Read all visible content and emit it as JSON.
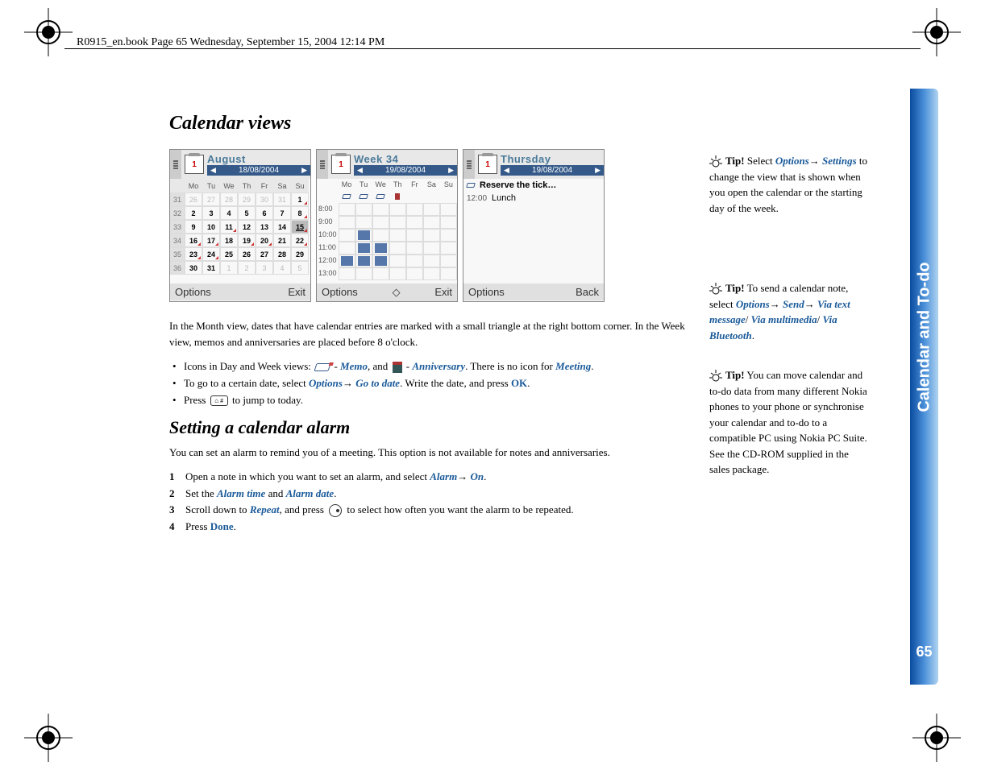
{
  "header": "R0915_en.book  Page 65  Wednesday, September 15, 2004  12:14 PM",
  "side_tab": {
    "label": "Calendar and To-do",
    "page": "65"
  },
  "section_title": "Calendar views",
  "screenshots": {
    "month": {
      "title": "August",
      "date": "18/08/2004",
      "days": [
        "Mo",
        "Tu",
        "We",
        "Th",
        "Fr",
        "Sa",
        "Su"
      ],
      "weeks": [
        "31",
        "32",
        "33",
        "34",
        "35",
        "36"
      ],
      "grid": [
        [
          "26",
          "27",
          "28",
          "29",
          "30",
          "31",
          "1"
        ],
        [
          "2",
          "3",
          "4",
          "5",
          "6",
          "7",
          "8"
        ],
        [
          "9",
          "10",
          "11",
          "12",
          "13",
          "14",
          "15"
        ],
        [
          "16",
          "17",
          "18",
          "19",
          "20",
          "21",
          "22"
        ],
        [
          "23",
          "24",
          "25",
          "26",
          "27",
          "28",
          "29"
        ],
        [
          "30",
          "31",
          "1",
          "2",
          "3",
          "4",
          "5"
        ]
      ],
      "left": "Options",
      "right": "Exit"
    },
    "week": {
      "title": "Week 34",
      "date": "19/08/2004",
      "days": [
        "Mo",
        "Tu",
        "We",
        "Th",
        "Fr",
        "Sa",
        "Su"
      ],
      "times": [
        "8:00",
        "9:00",
        "10:00",
        "11:00",
        "12:00",
        "13:00"
      ],
      "left": "Options",
      "right": "Exit"
    },
    "day": {
      "title": "Thursday",
      "date": "19/08/2004",
      "reserve": "Reserve the tick…",
      "entry_time": "12:00",
      "entry_text": "Lunch",
      "left": "Options",
      "right": "Back"
    }
  },
  "para1": "In the Month view, dates that have calendar entries are marked with a small triangle at the right bottom corner. In the Week view, memos and anniversaries are placed before 8 o'clock.",
  "bullets": {
    "b1a": "Icons in Day and Week views: ",
    "b1b": " - ",
    "b1_memo": "Memo",
    "b1c": ", and ",
    "b1_anniv": "Anniversary",
    "b1d": ". There is no icon for ",
    "b1_meeting": "Meeting",
    "b1e": ".",
    "b2a": "To go to a certain date, select ",
    "b2_opt": "Options",
    "b2_arrow": "→ ",
    "b2_goto": "Go to date",
    "b2b": ". Write the date, and press ",
    "b2_ok": "OK",
    "b2c": ".",
    "b3a": "Press ",
    "b3b": " to jump to today."
  },
  "sub_title": "Setting a calendar alarm",
  "para2": "You can set an alarm to remind you of a meeting. This option is not available for notes and anniversaries.",
  "steps": {
    "s1a": "Open a note in which you want to set an alarm, and select ",
    "s1_alarm": "Alarm",
    "s1_arrow": "→ ",
    "s1_on": "On",
    "s1b": ".",
    "s2a": "Set the ",
    "s2_at": "Alarm time",
    "s2b": " and ",
    "s2_ad": "Alarm date",
    "s2c": ".",
    "s3a": "Scroll down to ",
    "s3_rep": "Repeat",
    "s3b": ", and press ",
    "s3c": " to select how often you want the alarm to be repeated.",
    "s4a": "Press ",
    "s4_done": "Done",
    "s4b": "."
  },
  "tips": {
    "t1a": "Tip!",
    "t1b": " Select ",
    "t1_opt": "Options",
    "t1_arrow": "→ ",
    "t1_set": "Settings",
    "t1c": " to change the view that is shown when you open the calendar or the starting day of the week.",
    "t2a": "Tip!",
    "t2b": " To send a calendar note, select ",
    "t2_opt": "Options",
    "t2_a1": "→ ",
    "t2_send": "Send",
    "t2_a2": "→ ",
    "t2_via1": "Via text message",
    "t2_s1": "/ ",
    "t2_via2": "Via multimedia",
    "t2_s2": "/ ",
    "t2_via3": "Via Bluetooth",
    "t2c": ".",
    "t3a": "Tip!",
    "t3b": " You can move calendar and to-do data from many different Nokia phones to your phone or synchronise your calendar and to-do to a compatible PC using Nokia PC Suite. See the CD-ROM supplied in the sales package."
  }
}
